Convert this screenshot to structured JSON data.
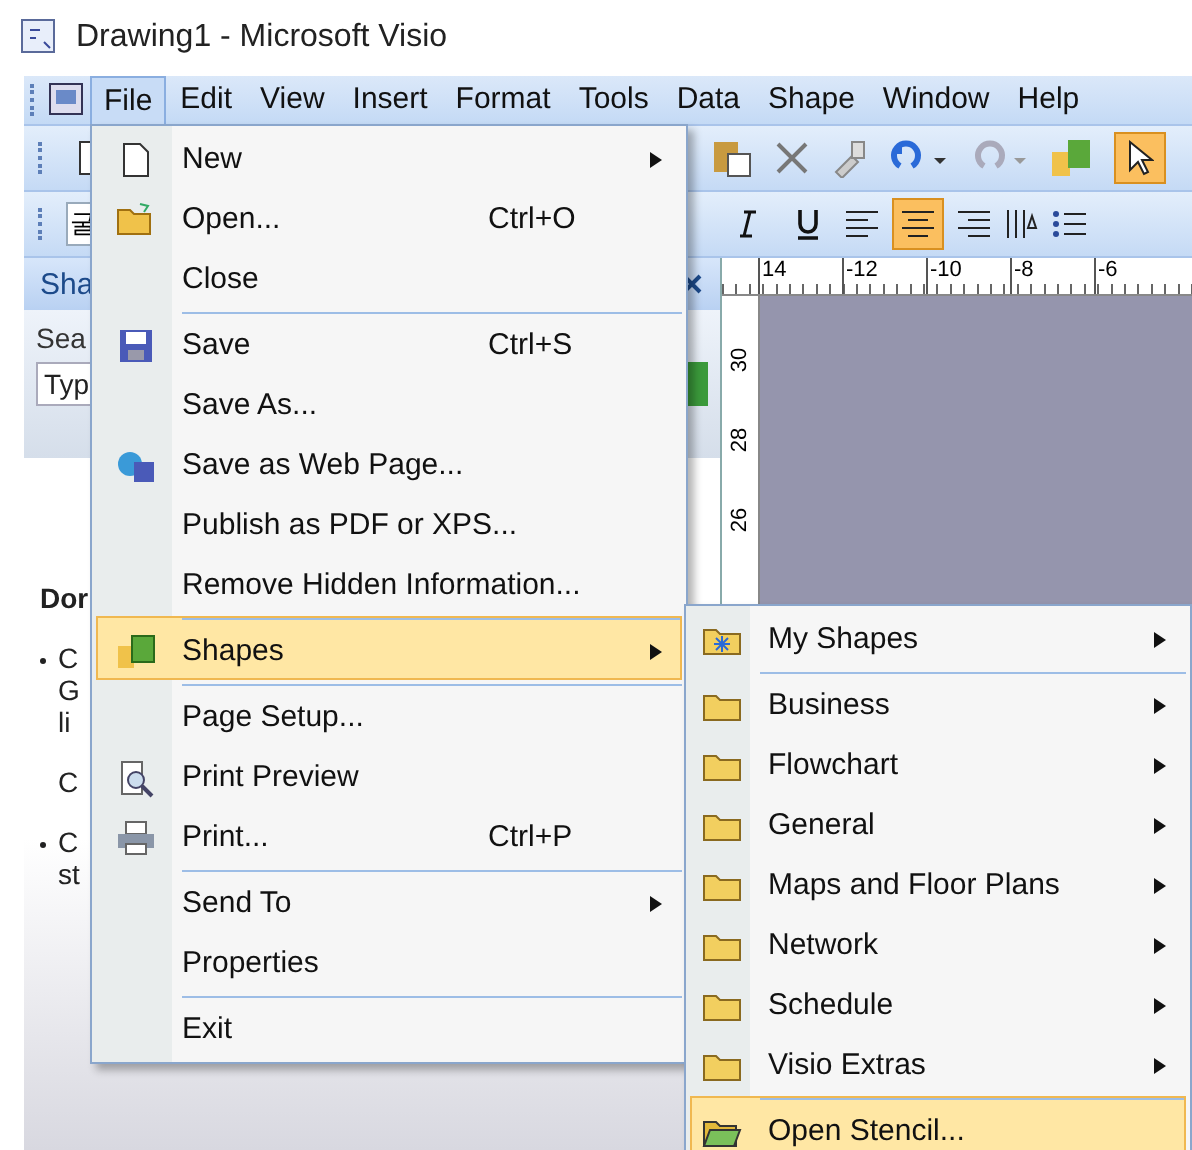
{
  "window": {
    "title": "Drawing1 - Microsoft Visio"
  },
  "menu_bar": [
    {
      "label": "File",
      "selected": true
    },
    {
      "label": "Edit",
      "selected": false
    },
    {
      "label": "View",
      "selected": false
    },
    {
      "label": "Insert",
      "selected": false
    },
    {
      "label": "Format",
      "selected": false
    },
    {
      "label": "Tools",
      "selected": false
    },
    {
      "label": "Data",
      "selected": false
    },
    {
      "label": "Shape",
      "selected": false
    },
    {
      "label": "Window",
      "selected": false
    },
    {
      "label": "Help",
      "selected": false
    }
  ],
  "format_toolbar": {
    "font_field": "굴"
  },
  "shapes_panel": {
    "title": "Sha",
    "search_label": "Sea",
    "search_placeholder": "Typ",
    "content": [
      {
        "kind": "heading",
        "lines": [
          "Dor"
        ]
      },
      {
        "kind": "bullet",
        "lines": [
          "C",
          "G",
          "li"
        ]
      },
      {
        "kind": "para",
        "lines": [
          "C"
        ]
      },
      {
        "kind": "bullet",
        "lines": [
          "C",
          "st"
        ]
      }
    ]
  },
  "ruler": {
    "horizontal": [
      "14",
      "-12",
      "-10",
      "-8",
      "-6"
    ],
    "vertical": [
      "30",
      "28",
      "26"
    ]
  },
  "file_menu": [
    {
      "label": "New",
      "submenu": true,
      "separator_before": false,
      "highlighted": false
    },
    {
      "label": "Open...",
      "shortcut": "Ctrl+O",
      "submenu": false,
      "separator_before": false,
      "highlighted": false
    },
    {
      "label": "Close",
      "submenu": false,
      "separator_before": false,
      "highlighted": false
    },
    {
      "label": "Save",
      "shortcut": "Ctrl+S",
      "submenu": false,
      "separator_before": true,
      "highlighted": false
    },
    {
      "label": "Save As...",
      "submenu": false,
      "separator_before": false,
      "highlighted": false
    },
    {
      "label": "Save as Web Page...",
      "submenu": false,
      "separator_before": false,
      "highlighted": false
    },
    {
      "label": "Publish as PDF or XPS...",
      "submenu": false,
      "separator_before": false,
      "highlighted": false
    },
    {
      "label": "Remove Hidden Information...",
      "submenu": false,
      "separator_before": false,
      "highlighted": false
    },
    {
      "label": "Shapes",
      "submenu": true,
      "separator_before": true,
      "highlighted": true
    },
    {
      "label": "Page Setup...",
      "submenu": false,
      "separator_before": true,
      "highlighted": false
    },
    {
      "label": "Print Preview",
      "submenu": false,
      "separator_before": false,
      "highlighted": false
    },
    {
      "label": "Print...",
      "shortcut": "Ctrl+P",
      "submenu": false,
      "separator_before": false,
      "highlighted": false
    },
    {
      "label": "Send To",
      "submenu": true,
      "separator_before": true,
      "highlighted": false
    },
    {
      "label": "Properties",
      "submenu": false,
      "separator_before": false,
      "highlighted": false
    },
    {
      "label": "Exit",
      "submenu": false,
      "separator_before": true,
      "highlighted": false
    }
  ],
  "shapes_submenu": [
    {
      "label": "My Shapes",
      "submenu": true,
      "separator_before": false,
      "highlighted": false
    },
    {
      "label": "Business",
      "submenu": true,
      "separator_before": true,
      "highlighted": false
    },
    {
      "label": "Flowchart",
      "submenu": true,
      "separator_before": false,
      "highlighted": false
    },
    {
      "label": "General",
      "submenu": true,
      "separator_before": false,
      "highlighted": false
    },
    {
      "label": "Maps and Floor Plans",
      "submenu": true,
      "separator_before": false,
      "highlighted": false
    },
    {
      "label": "Network",
      "submenu": true,
      "separator_before": false,
      "highlighted": false
    },
    {
      "label": "Schedule",
      "submenu": true,
      "separator_before": false,
      "highlighted": false
    },
    {
      "label": "Visio Extras",
      "submenu": true,
      "separator_before": false,
      "highlighted": false
    },
    {
      "label": "Open Stencil...",
      "submenu": false,
      "separator_before": true,
      "highlighted": true
    }
  ]
}
